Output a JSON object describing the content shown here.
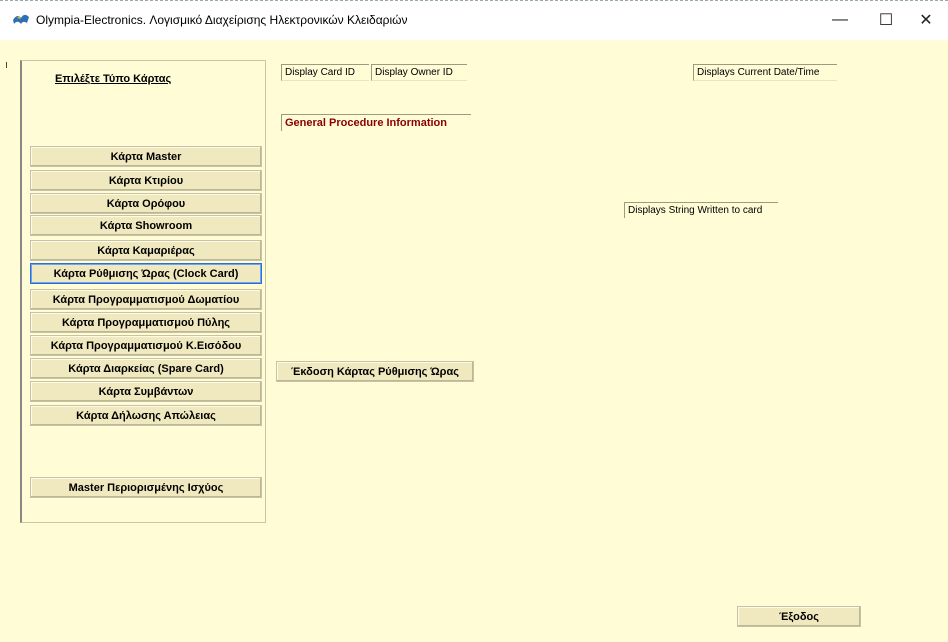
{
  "window": {
    "title": "Olympia-Electronics. Λογισμικό Διαχείρισης Ηλεκτρονικών Κλειδαριών",
    "controls": {
      "minimize": "—",
      "maximize": "☐",
      "close": "✕"
    }
  },
  "panel": {
    "heading": "Επιλέξτε Τύπο Κάρτας",
    "cards": [
      "Κάρτα  Master",
      "Κάρτα Κτιρίου",
      "Κάρτα Ορόφου",
      "Κάρτα Showroom",
      "Κάρτα Καμαριέρας",
      "Κάρτα Ρύθμισης Ώρας (Clock Card)",
      "Κάρτα Προγραμματισμού Δωματίου",
      "Κάρτα Προγραμματισμού Πύλης",
      "Κάρτα Προγραμματισμού Κ.Εισόδου",
      "Κάρτα Διαρκείας (Spare Card)",
      "Κάρτα Συμβάντων",
      "Κάρτα Δήλωσης Απώλειας"
    ],
    "selected_card": "Κάρτα Ρύθμισης Ώρας (Clock Card)",
    "restricted_master": "Master Περιορισμένης Ισχύος"
  },
  "info": {
    "card_id": "Display Card ID",
    "owner_id": "Display Owner ID",
    "datetime": "Displays Current Date/Time",
    "procedure": "General Procedure Information",
    "string_written": "Displays String Written to card"
  },
  "actions": {
    "issue": "Έκδοση Κάρτας Ρύθμισης Ώρας",
    "exit": "Έξοδος"
  },
  "colors": {
    "background": "#fffcd6",
    "button": "#f0e9c0",
    "procedure_text": "#8b0000",
    "selected_border": "#2b6fd6"
  }
}
